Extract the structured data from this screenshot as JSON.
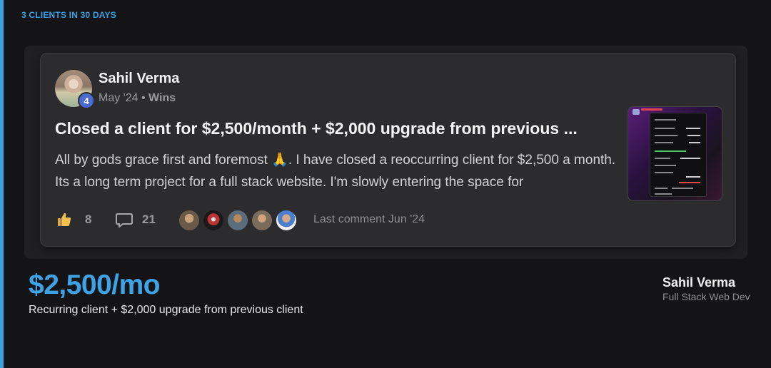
{
  "eyebrow": "3 CLIENTS IN 30 DAYS",
  "post": {
    "author": "Sahil Verma",
    "level": "4",
    "date": "May '24",
    "separator": "•",
    "category": "Wins",
    "title": "Closed a client for $2,500/month + $2,000 upgrade from previous ...",
    "body_before_emoji": "All by gods grace first and foremost ",
    "emoji": "🙏",
    "body_after_emoji": ". I have closed a reoccurring client for $2,500 a month. Its a long term project for a full stack website. I'm slowly entering the space for",
    "likes": "8",
    "comments": "21",
    "last_comment": "Last comment Jun '24"
  },
  "result": {
    "price": "$2,500/mo",
    "description": "Recurring client + $2,000 upgrade from previous client"
  },
  "person": {
    "name": "Sahil Verma",
    "role": "Full Stack Web Dev"
  },
  "colors": {
    "accent": "#3b9fe0",
    "background": "#141416",
    "card": "#2c2c2e",
    "level_badge": "#4a6bd4"
  },
  "icons": {
    "like": "thumbs-up-icon",
    "comment": "comment-bubble-icon"
  }
}
